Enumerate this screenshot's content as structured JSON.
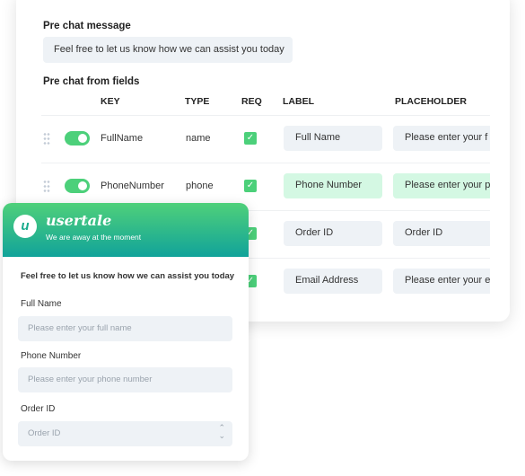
{
  "settings": {
    "pre_chat_message_label": "Pre chat message",
    "pre_chat_message_value": "Feel free to let us know how we can assist you today",
    "fields_label": "Pre chat from fields",
    "columns": [
      "KEY",
      "TYPE",
      "REQ",
      "LABEL",
      "PLACEHOLDER"
    ],
    "rows": [
      {
        "key": "FullName",
        "type": "name",
        "enabled": true,
        "required": true,
        "label": "Full Name",
        "placeholder": "Please enter your f",
        "highlight": false
      },
      {
        "key": "PhoneNumber",
        "type": "phone",
        "enabled": true,
        "required": true,
        "label": "Phone Number",
        "placeholder": "Please enter your p",
        "highlight": true
      },
      {
        "key": "",
        "type": "",
        "enabled": true,
        "required": true,
        "label": "Order ID",
        "placeholder": "Order ID",
        "highlight": false
      },
      {
        "key": "",
        "type": "",
        "enabled": true,
        "required": true,
        "label": "Email Address",
        "placeholder": "Please enter your e",
        "highlight": false
      }
    ]
  },
  "widget": {
    "brand": "usertale",
    "status": "We are away at the moment",
    "message": "Feel free to let us know how we can assist you today",
    "fields": [
      {
        "label": "Full Name",
        "placeholder": "Please enter your full name"
      },
      {
        "label": "Phone Number",
        "placeholder": "Please enter your phone number"
      },
      {
        "label": "Order ID",
        "placeholder": "Order ID",
        "select": true
      }
    ],
    "colors": {
      "gradient_top": "#4fd07a",
      "gradient_bottom": "#11a39a"
    }
  },
  "colors": {
    "accent": "#4cd07a",
    "highlight": "#d4f8e3",
    "input_bg": "#eef2f6"
  }
}
